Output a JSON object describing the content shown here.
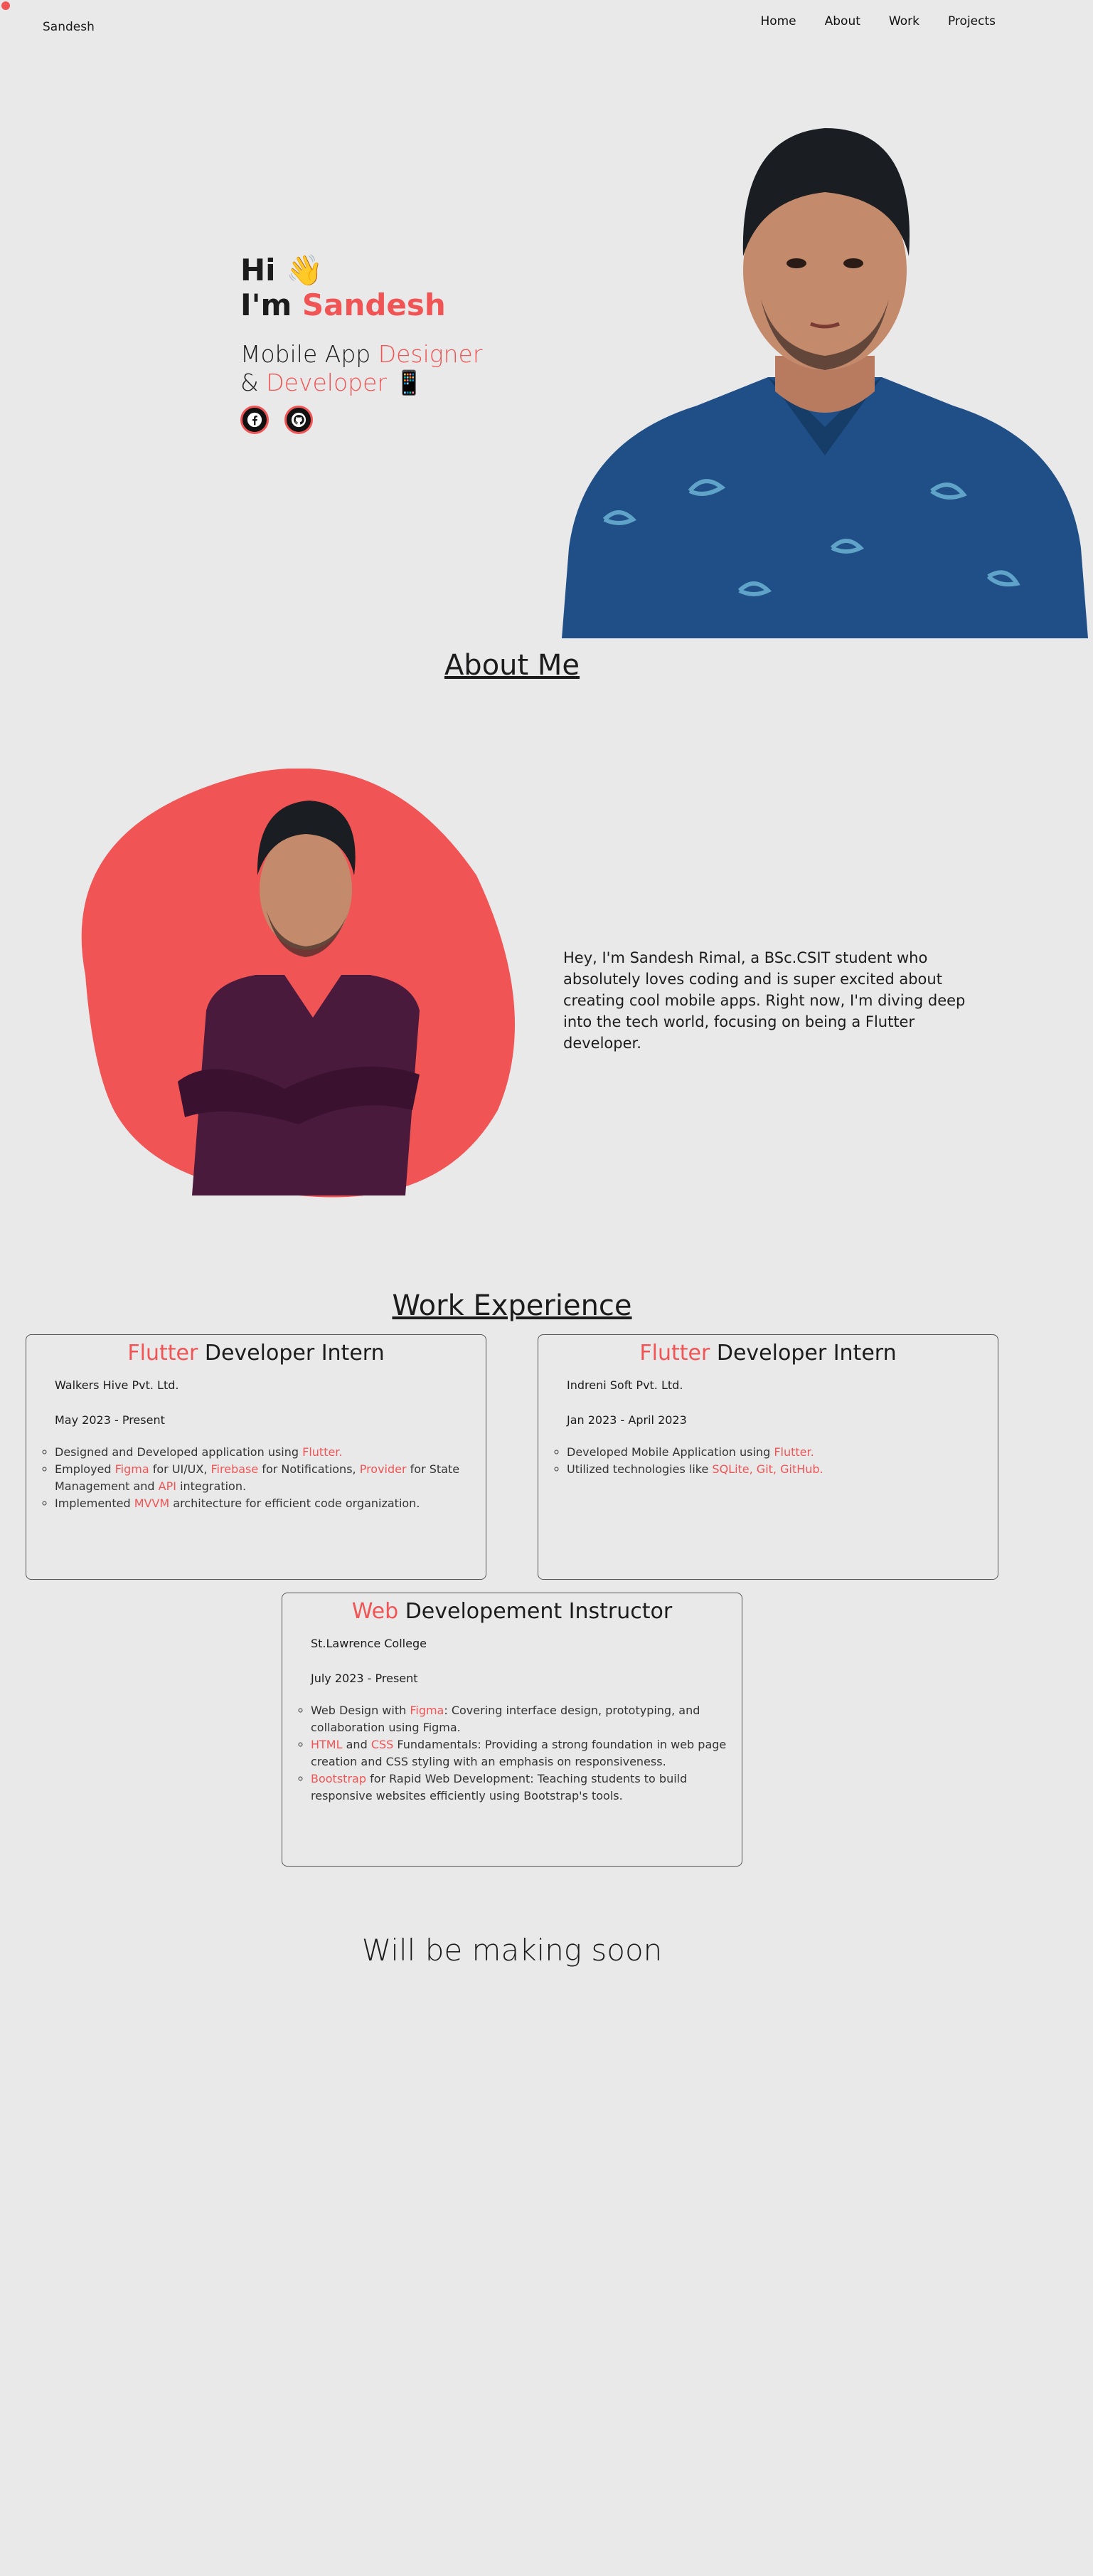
{
  "nav": {
    "brand": "Sandesh",
    "links": [
      "Home",
      "About",
      "Work",
      "Projects"
    ]
  },
  "hero": {
    "greeting": "Hi",
    "wave_emoji": "👋",
    "im_prefix": "I'm",
    "name": "Sandesh",
    "tagline_part1": "Mobile App",
    "tagline_accent1": "Designer",
    "tagline_part2": "&",
    "tagline_accent2": "Developer",
    "phone_emoji": "📱",
    "socials": [
      "facebook-icon",
      "github-icon"
    ]
  },
  "about": {
    "title": "About Me",
    "text": "Hey, I'm Sandesh Rimal, a BSc.CSIT student who absolutely loves coding and is super excited about creating cool mobile apps. Right now, I'm diving deep into the tech world, focusing on being a Flutter developer."
  },
  "work": {
    "title": "Work Experience",
    "jobs": [
      {
        "title_accent": "Flutter",
        "title_rest": " Developer Intern",
        "company": "Walkers Hive Pvt. Ltd.",
        "dates": "May 2023 - Present",
        "bullets": [
          [
            {
              "t": "Designed and Developed application using "
            },
            {
              "t": "Flutter.",
              "a": true
            }
          ],
          [
            {
              "t": "Employed "
            },
            {
              "t": "Figma",
              "a": true
            },
            {
              "t": " for UI/UX, "
            },
            {
              "t": "Firebase",
              "a": true
            },
            {
              "t": " for Notifications, "
            },
            {
              "t": "Provider",
              "a": true
            },
            {
              "t": " for State Management and "
            },
            {
              "t": "API",
              "a": true
            },
            {
              "t": " integration."
            }
          ],
          [
            {
              "t": "Implemented "
            },
            {
              "t": "MVVM",
              "a": true
            },
            {
              "t": " architecture for efficient code organization."
            }
          ]
        ]
      },
      {
        "title_accent": "Flutter",
        "title_rest": " Developer Intern",
        "company": "Indreni Soft Pvt. Ltd.",
        "dates": "Jan 2023 - April 2023",
        "bullets": [
          [
            {
              "t": "Developed Mobile Application using "
            },
            {
              "t": "Flutter.",
              "a": true
            }
          ],
          [
            {
              "t": "Utilized technologies like "
            },
            {
              "t": "SQLite, Git, GitHub.",
              "a": true
            }
          ]
        ]
      },
      {
        "title_accent": "Web",
        "title_rest": " Developement Instructor",
        "company": "St.Lawrence College",
        "dates": "July 2023 - Present",
        "bullets": [
          [
            {
              "t": "Web Design with "
            },
            {
              "t": "Figma",
              "a": true
            },
            {
              "t": ": Covering interface design, prototyping, and collaboration using Figma."
            }
          ],
          [
            {
              "t": "HTML",
              "a": true
            },
            {
              "t": " and "
            },
            {
              "t": "CSS",
              "a": true
            },
            {
              "t": " Fundamentals: Providing a strong foundation in web page creation and CSS styling with an emphasis on responsiveness."
            }
          ],
          [
            {
              "t": "Bootstrap",
              "a": true
            },
            {
              "t": " for Rapid Web Development: Teaching students to build responsive websites efficiently using Bootstrap's tools."
            }
          ]
        ]
      }
    ]
  },
  "projects": {
    "placeholder": "Will be making soon"
  },
  "colors": {
    "accent": "#f05454",
    "background": "#e9e9ea",
    "text": "#1c1c1c"
  }
}
